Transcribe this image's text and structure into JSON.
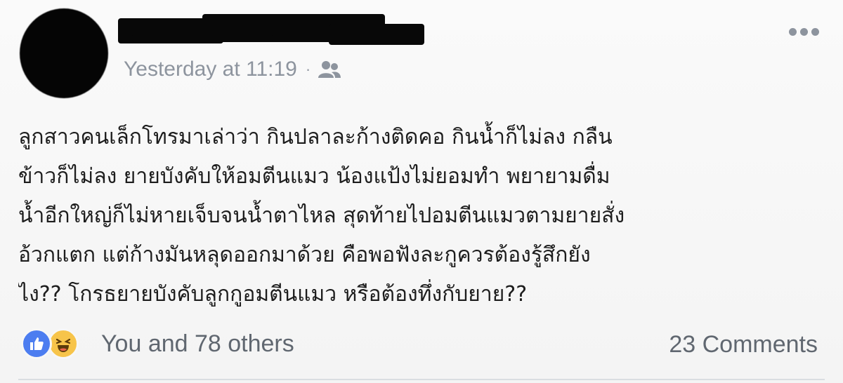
{
  "post": {
    "timestamp": "Yesterday at 11:19",
    "separator": "·",
    "audience_icon": "friends-icon",
    "more_icon": "more-options-icon",
    "body_lines": [
      "ลูกสาวคนเล็กโทรมาเล่าว่า กินปลาละก้างติดคอ  กินน้ำก็ไม่ลง กลืน",
      "ข้าวก็ไม่ลง  ยายบังคับให้อมตีนแมว  น้องแป้งไม่ยอมทำ  พยายามดื่ม",
      "น้ำอีกใหญ่ก็ไม่หายเจ็บจนน้ำตาไหล สุดท้ายไปอมตีนแมวตามยายสั่ง",
      "อ้วกแตก  แต่ก้างมันหลุดออกมาด้วย  คือพอฟังละกูควรต้องรู้สึกยัง",
      "ไง??  โกรธยายบังคับลูกกูอมตีนแมว  หรือต้องทึ่งกับยาย??"
    ]
  },
  "reactions": {
    "icons": [
      "like-icon",
      "haha-icon"
    ],
    "label": "You and 78 others",
    "like_color": "#4c7df0",
    "haha_color": "#f7c44a"
  },
  "comments": {
    "label": "23 Comments"
  }
}
